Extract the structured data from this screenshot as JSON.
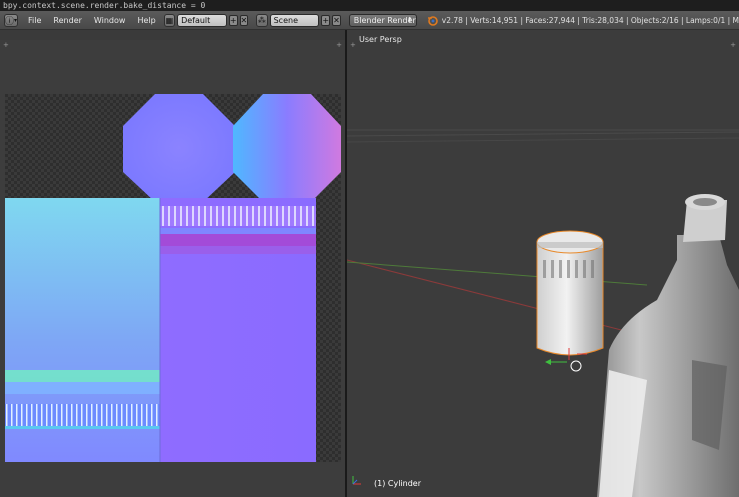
{
  "console": {
    "text": "bpy.context.scene.render.bake_distance = 0"
  },
  "menu": {
    "items": [
      "File",
      "Render",
      "Window",
      "Help"
    ]
  },
  "screen_layout": {
    "value": "Default"
  },
  "scene": {
    "value": "Scene"
  },
  "render_engine": {
    "value": "Blender Render"
  },
  "stats": {
    "text": "v2.78 | Verts:14,951 | Faces:27,944 | Tris:28,034 | Objects:2/16 | Lamps:0/1 | M"
  },
  "viewport": {
    "label": "User Persp",
    "object_label": "(1) Cylinder"
  },
  "colors": {
    "accent_orange": "#e07a1f",
    "selection_orange": "#e8892a",
    "normal_blue": "#8080ff"
  },
  "icons": [
    "info-icon",
    "layout-icon",
    "scene-icon",
    "add-icon",
    "close-icon",
    "blender-logo-icon",
    "chevron-down-icon"
  ]
}
